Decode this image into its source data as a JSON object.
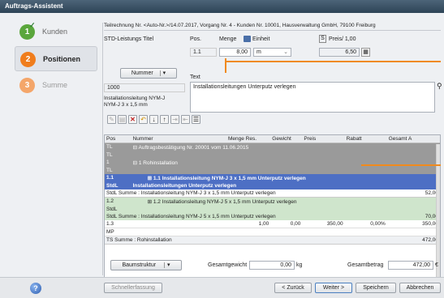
{
  "window": {
    "title": "Auftrags-Assistent"
  },
  "steps": [
    {
      "number": "1",
      "label": "Kunden",
      "color": "#5aa63c",
      "state": "done"
    },
    {
      "number": "2",
      "label": "Positionen",
      "color": "#f07d1c",
      "state": "active"
    },
    {
      "number": "3",
      "label": "Summe",
      "color": "#f4a66a",
      "state": "off"
    }
  ],
  "header": {
    "info": "Teilrechnung Nr. <Auto-Nr.>/14.07.2017, Vorgang Nr. 4 - Kunden Nr. 10001, Hausverwaltung GmbH, 79100 Freiburg",
    "std_label": "STD-Leistungs Titel",
    "pos_label": "Pos.",
    "menge_label": "Menge",
    "einheit_label": "Einheit",
    "s_label": "S",
    "preis_label": "Preis/ 1,00",
    "pos_value": "1.1",
    "menge_value": "8,00",
    "einheit_value": "m",
    "preis_value": "6,50"
  },
  "nummer_button": "Nummer",
  "text_label": "Text",
  "text_value": "Installationsleitungen Unterputz verlegen",
  "nummer_value": "1000",
  "item_desc": "Installationsleitung NYM-J\nNYM-J 3 x 1,5 mm",
  "table": {
    "headers": [
      "Pos",
      "Nummer",
      "Menge Res.",
      "Gewicht",
      "Preis",
      "Rabatt",
      "Gesamt A"
    ],
    "rows": [
      {
        "style": "r-gray",
        "pos": "TL",
        "text": "⊟  Auftragsbestätigung Nr. 20001 vom 11.06.2015"
      },
      {
        "style": "r-gray",
        "pos": "TL",
        "text": ""
      },
      {
        "style": "r-gray",
        "pos": "1",
        "text": "⊟ 1 Rohinstallation"
      },
      {
        "style": "r-gray",
        "pos": "TL",
        "text": ""
      },
      {
        "style": "r-blue",
        "pos": "1.1",
        "text": "⊞ 1.1 Installationsleitung NYM-J 3 x 1,5 mm Unterputz verlegen"
      },
      {
        "style": "r-blue",
        "pos": "StdL",
        "text": "Installationsleitungen Unterputz verlegen"
      },
      {
        "style": "r-sum",
        "pos": "StdL Summe : Installationsleitung NYM-J 3 x 1,5 mm Unterputz verlegen",
        "gesamt": "52,00"
      },
      {
        "style": "r-green",
        "pos": "1.2",
        "text": "⊞ 1.2 Installationsleitung NYM-J 5 x 1,5 mm Unterputz verlegen"
      },
      {
        "style": "r-green",
        "pos": "StdL",
        "text": ""
      },
      {
        "style": "r-green",
        "pos": "StdL Summe : Installationsleitung NYM-J 5 x 1,5 mm Unterputz verlegen",
        "gesamt": "70,00"
      },
      {
        "style": "r-white",
        "pos": "1.3",
        "menge": "1,00",
        "gewicht": "0,00",
        "preis": "350,00",
        "rabatt": "0,00%",
        "gesamt": "350,00"
      },
      {
        "style": "r-white",
        "pos": "MP",
        "text": ""
      },
      {
        "style": "r-sum",
        "pos": "TS Summe : Rohinstallation",
        "gesamt": "472,00"
      }
    ]
  },
  "bottom": {
    "baumstruktur": "Baumstruktur",
    "gesamtgewicht_label": "Gesamtgewicht",
    "gesamtgewicht_value": "0,00",
    "gesamtgewicht_unit": "kg",
    "gesamtbetrag_label": "Gesamtbetrag",
    "gesamtbetrag_value": "472,00",
    "gesamtbetrag_unit": "€"
  },
  "footer": {
    "help": "?",
    "schnellerfassung": "Schnellerfassung",
    "zurueck": "< Zurück",
    "weiter": "Weiter >",
    "speichern": "Speichern",
    "abbrechen": "Abbrechen"
  }
}
